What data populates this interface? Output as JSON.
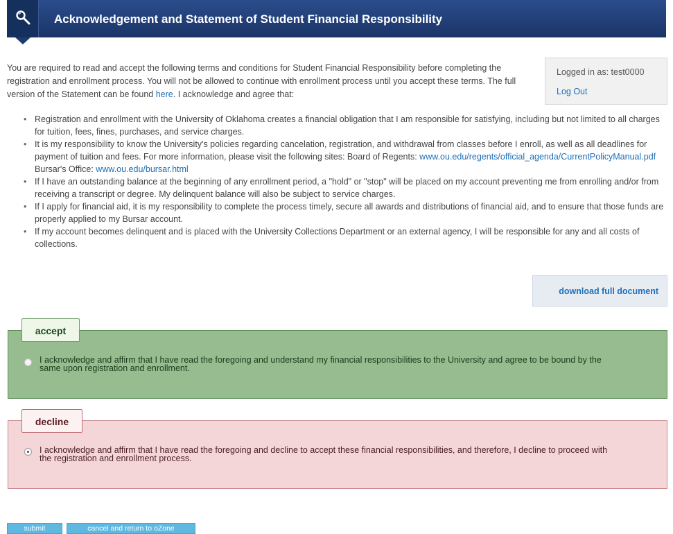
{
  "header": {
    "title": "Acknowledgement and Statement of Student Financial Responsibility",
    "icon": "magnifier-icon"
  },
  "intro": {
    "text_before_link": "You are required to read and accept the following terms and conditions for Student Financial Responsibility before completing the registration and enrollment process. You will not be allowed to continue with enrollment process until you accept these terms. The full version of the Statement can be found ",
    "link_text": "here",
    "text_after_link": ". I acknowledge and agree that:"
  },
  "login": {
    "label": "Logged in as: test0000",
    "logout": "Log Out"
  },
  "terms": [
    "Registration and enrollment with the University of Oklahoma creates a financial obligation that I am responsible for satisfying, including but not limited to all charges for tuition, fees, fines, purchases, and service charges.",
    "It is my responsibility to know the University's policies regarding cancelation, registration, and withdrawal from classes before I enroll, as well as all deadlines for payment of tuition and fees. For more information, please visit the following sites: Board of Regents:",
    "If I have an outstanding balance at the beginning of any enrollment period, a \"hold\" or \"stop\" will be placed on my account preventing me from enrolling and/or from receiving a transcript or degree. My delinquent balance will also be subject to service charges.",
    "If I apply for financial aid, it is my responsibility to complete the process timely, secure all awards and distributions of financial aid, and to ensure that those funds are properly applied to my Bursar account.",
    "If my account becomes delinquent and is placed with the University Collections Department or an external agency, I will be responsible for any and all costs of collections."
  ],
  "term2_links": {
    "regents_url": "www.ou.edu/regents/official_agenda/CurrentPolicyManual.pdf",
    "bursar_label": " Bursar's Office: ",
    "bursar_url": "www.ou.edu/bursar.html"
  },
  "download": {
    "label": "download full document"
  },
  "accept": {
    "tab_label": "accept",
    "text": "I acknowledge and affirm that I have read the foregoing and understand my financial responsibilities to the University and agree to be bound by the same upon registration and enrollment.",
    "selected": false
  },
  "decline": {
    "tab_label": "decline",
    "text": "I acknowledge and affirm that I have read the foregoing and decline to accept these financial responsibilities, and therefore, I decline to proceed with the registration and enrollment process.",
    "selected": true
  },
  "buttons": {
    "submit": "submit",
    "cancel": "cancel and return to oZone"
  }
}
